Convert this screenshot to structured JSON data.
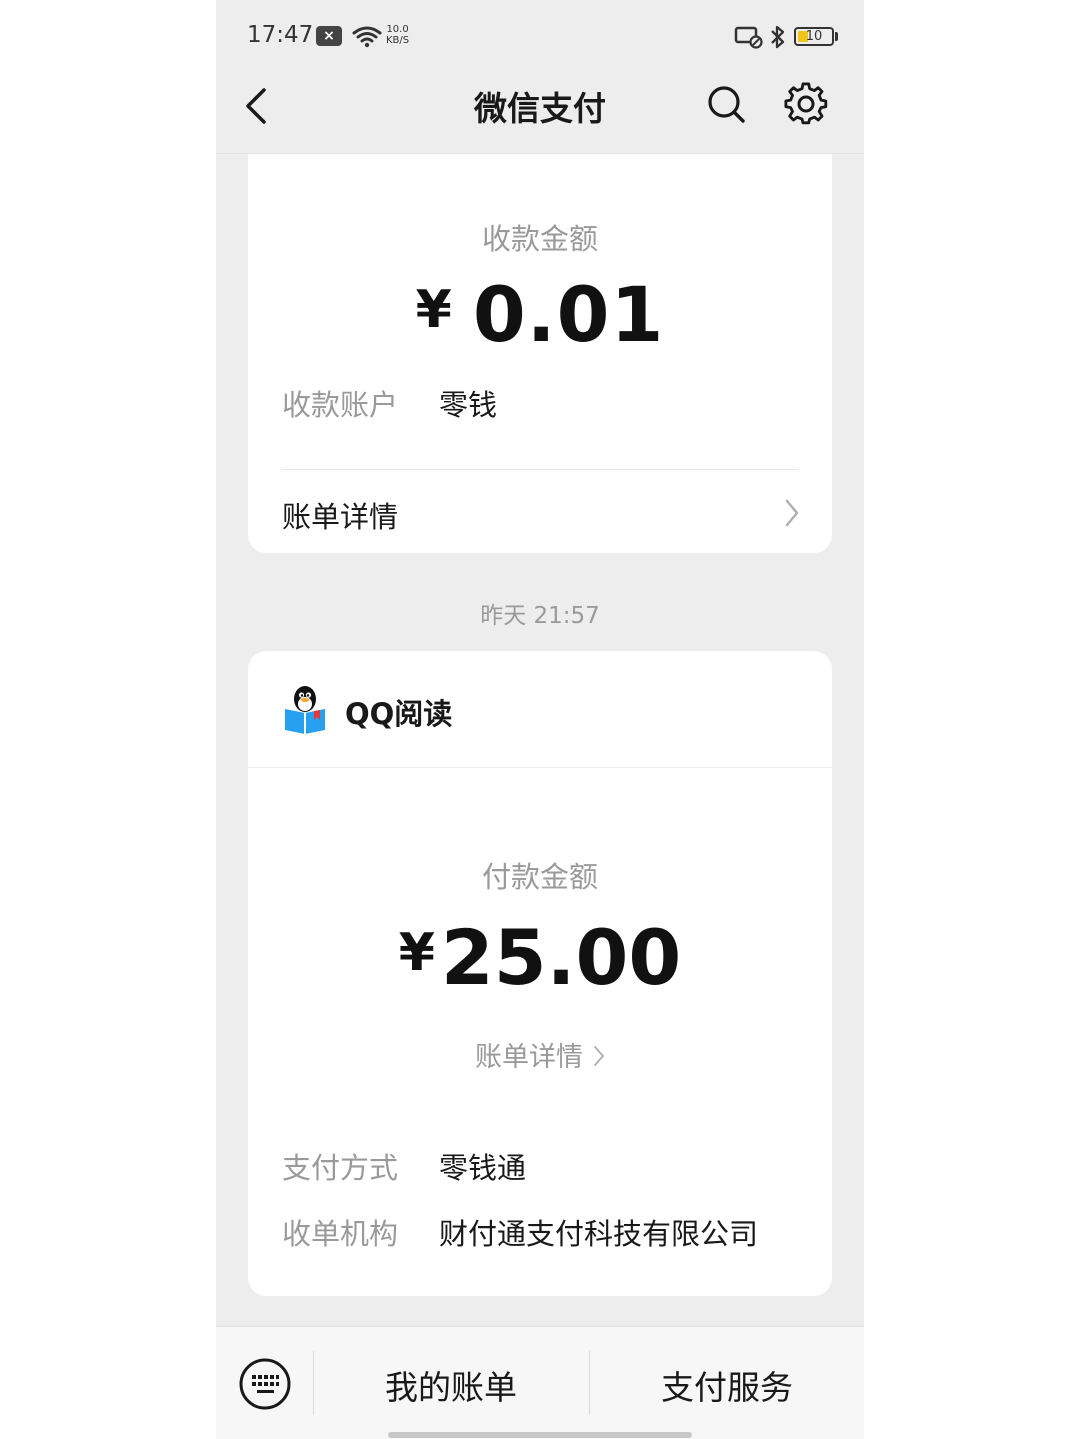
{
  "status_bar": {
    "time": "17:47",
    "notification_icon": "close-box-icon",
    "speed_top": "10.0",
    "speed_bottom": "KB/S",
    "battery": "10"
  },
  "header": {
    "title": "微信支付",
    "back_icon": "chevron-left-icon",
    "search_icon": "search-icon",
    "settings_icon": "gear-icon"
  },
  "card1": {
    "amount_label": "收款金额",
    "currency": "¥",
    "amount": "0.01",
    "account_label": "收款账户",
    "account_value": "零钱",
    "detail_label": "账单详情"
  },
  "timestamp": "昨天 21:57",
  "card2": {
    "merchant": "QQ阅读",
    "amount_label": "付款金额",
    "currency": "¥",
    "amount": "25.00",
    "detail_label": "账单详情",
    "pay_method_label": "支付方式",
    "pay_method_value": "零钱通",
    "org_label": "收单机构",
    "org_value": "财付通支付科技有限公司"
  },
  "bottom_bar": {
    "my_bill": "我的账单",
    "pay_service": "支付服务"
  },
  "colors": {
    "background": "#ededed",
    "card": "#ffffff",
    "text_primary": "#191919",
    "text_secondary": "#9a9a9a",
    "battery": "#f0c419"
  }
}
